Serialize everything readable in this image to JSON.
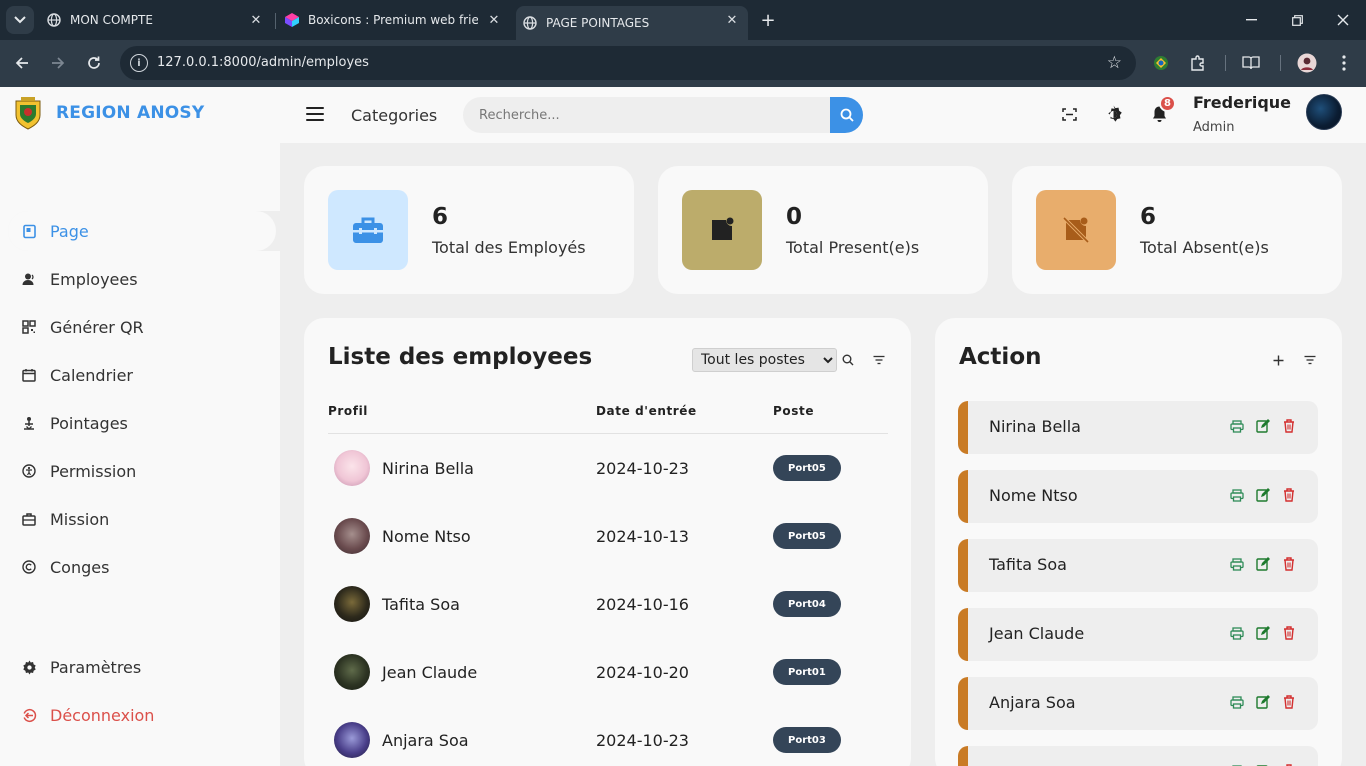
{
  "browser": {
    "tabs": [
      {
        "title": "MON COMPTE"
      },
      {
        "title": "Boxicons : Premium web friendly"
      },
      {
        "title": "PAGE POINTAGES"
      }
    ],
    "url": "127.0.0.1:8000/admin/employes"
  },
  "brand": {
    "name": "REGION ANOSY"
  },
  "sidebar": {
    "items": [
      {
        "label": "Page",
        "icon": "dashboard-icon",
        "active": true
      },
      {
        "label": "Employees",
        "icon": "user-icon"
      },
      {
        "label": "Générer QR",
        "icon": "qr-icon"
      },
      {
        "label": "Calendrier",
        "icon": "calendar-icon"
      },
      {
        "label": "Pointages",
        "icon": "fingerprint-icon"
      },
      {
        "label": "Permission",
        "icon": "accessibility-icon"
      },
      {
        "label": "Mission",
        "icon": "briefcase-icon"
      },
      {
        "label": "Conges",
        "icon": "copyright-icon"
      }
    ],
    "settings_label": "Paramètres",
    "logout_label": "Déconnexion"
  },
  "topnav": {
    "categories_label": "Categories",
    "search_placeholder": "Recherche...",
    "notification_count": "8",
    "user_name": "Frederique",
    "user_role": "Admin"
  },
  "stats": [
    {
      "value": "6",
      "label": "Total des Employés",
      "color": "#cfe8ff",
      "icon_color": "#3c91e6"
    },
    {
      "value": "0",
      "label": "Total Present(e)s",
      "color": "#bcac6b",
      "icon_color": "#222222"
    },
    {
      "value": "6",
      "label": "Total Absent(e)s",
      "color": "#e8ad6c",
      "icon_color": "#a85d1a"
    }
  ],
  "employee_list": {
    "title": "Liste des employees",
    "filter_selected": "Tout les postes",
    "headers": {
      "profile": "Profil",
      "date": "Date d'entrée",
      "poste": "Poste"
    },
    "rows": [
      {
        "name": "Nirina Bella",
        "date": "2024-10-23",
        "poste": "Port05"
      },
      {
        "name": "Nome Ntso",
        "date": "2024-10-13",
        "poste": "Port05"
      },
      {
        "name": "Tafita Soa",
        "date": "2024-10-16",
        "poste": "Port04"
      },
      {
        "name": "Jean Claude",
        "date": "2024-10-20",
        "poste": "Port01"
      },
      {
        "name": "Anjara Soa",
        "date": "2024-10-23",
        "poste": "Port03"
      }
    ]
  },
  "action_panel": {
    "title": "Action",
    "items": [
      {
        "name": "Nirina Bella"
      },
      {
        "name": "Nome Ntso"
      },
      {
        "name": "Tafita Soa"
      },
      {
        "name": "Jean Claude"
      },
      {
        "name": "Anjara Soa"
      },
      {
        "name": ""
      }
    ]
  },
  "colors": {
    "accent": "#3c91e6",
    "danger": "#db504a",
    "action_border": "#c97b25",
    "badge": "#344558"
  }
}
